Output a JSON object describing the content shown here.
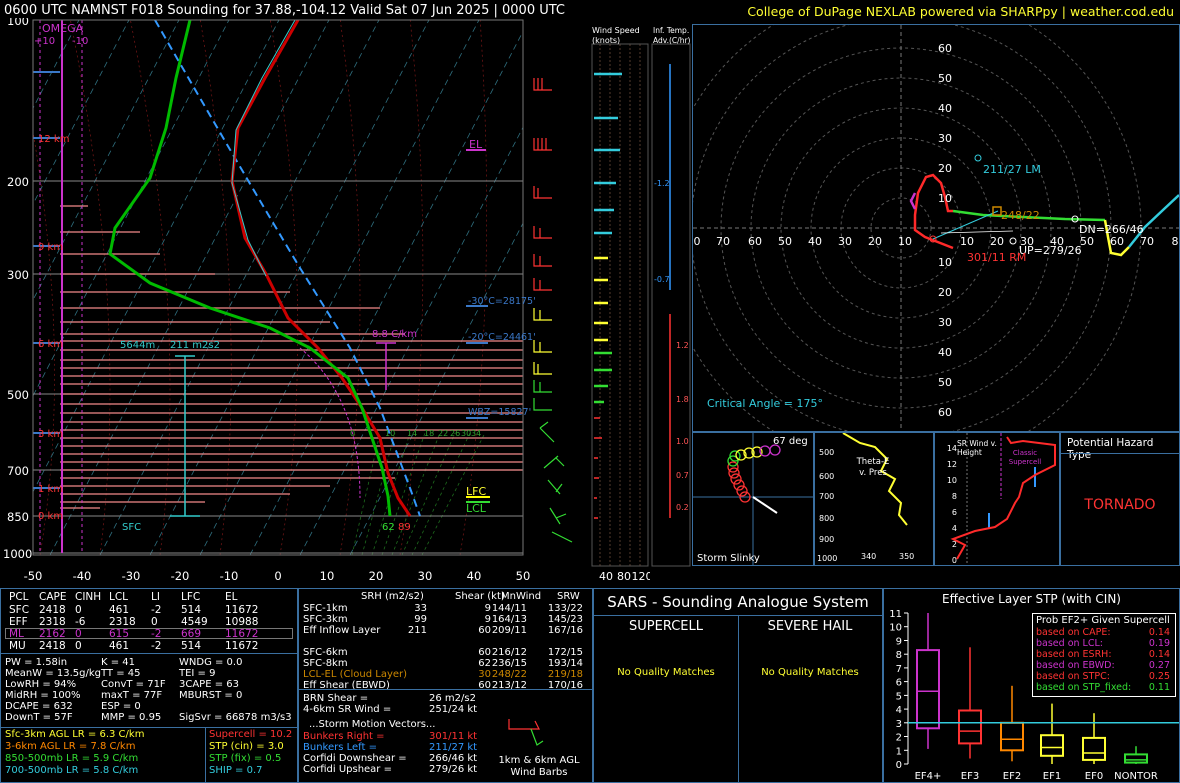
{
  "header": {
    "title": "0600 UTC NAMNST F018 Sounding for 37.88,-104.12 Valid  Sat 07 Jun 2025 | 0000 UTC",
    "credit": "College of DuPage NEXLAB powered via SHARPpy | weather.cod.edu"
  },
  "colors": {
    "temp": "#dd0000",
    "dewpoint": "#00bb00",
    "parcel": "#3399ff",
    "hodo_0_3": "#ff2a2a",
    "hodo_3_6": "#33dd33",
    "hodo_6_9": "#ffff33",
    "hodo_9_12": "#33ccdd",
    "omega": "#cc33cc",
    "accent_box": "#3a6fa0"
  },
  "skewt": {
    "p_ticks": [
      100,
      200,
      300,
      500,
      700,
      850,
      1000
    ],
    "x_ticks": [
      -50,
      -40,
      -30,
      -20,
      -10,
      0,
      10,
      20,
      30,
      40,
      50
    ],
    "height_labels": [
      "12 km",
      "9 km",
      "6 km",
      "3 km",
      "1 km",
      "0 km"
    ],
    "omega_label": "OMEGA",
    "omega_ticks": [
      "+10",
      "-10"
    ],
    "el_label": "EL",
    "lfc_label": "LFC",
    "lcl_label": "LCL",
    "lapse_label": "8.8 C/km",
    "isotherm_m30": "-30°C=28175'",
    "isotherm_m20": "-20°C=24461'",
    "wbz_label": "WBZ=15827'",
    "sfc_label": "SFC",
    "eff_inflow_depth": "5644m",
    "eff_srh": "211 m2s2",
    "sfc_t": "62",
    "sfc_td": "89",
    "wetbulb_ticks": [
      "0",
      "10",
      "14",
      "18",
      "22",
      "26",
      "30",
      "34"
    ]
  },
  "wind_speed_panel": {
    "title": "Wind Speed (knots)",
    "ticks": [
      "40",
      "80",
      "120"
    ]
  },
  "temp_adv_panel": {
    "title": "Inf. Temp. Adv.(C/hr)",
    "values": [
      "-1.2",
      "-0.7",
      "1.2",
      "1.8",
      "1.0",
      "0.7",
      "0.2"
    ]
  },
  "hodograph": {
    "rings_up": [
      "60",
      "50",
      "40",
      "30",
      "20",
      "10"
    ],
    "rings_down": [
      "10",
      "20",
      "30",
      "40",
      "50",
      "60"
    ],
    "x_ticks": [
      "0",
      "70",
      "60",
      "50",
      "40",
      "30",
      "20",
      "10",
      "10",
      "20",
      "30",
      "40",
      "50",
      "60",
      "70",
      "8"
    ],
    "lm": "211/27 LM",
    "rm": "301/11 RM",
    "mean": "248/22",
    "dn": "DN=266/46",
    "up": "UP=279/26",
    "critical_angle": "Critical Angle = 175°"
  },
  "slinky": {
    "title": "Storm Slinky",
    "deg": "67 deg"
  },
  "theta_panel": {
    "title": "Theta-E v. Pres",
    "p_ticks": [
      "500",
      "600",
      "700",
      "800",
      "900",
      "1000"
    ],
    "x_ticks": [
      "340",
      "350"
    ]
  },
  "srwind_panel": {
    "title": "SR Wind v. Height",
    "y_ticks": [
      "14",
      "12",
      "10",
      "8",
      "6",
      "4",
      "2",
      "0"
    ],
    "label": "Classic Supercell"
  },
  "hazard": {
    "title": "Potential Hazard Type",
    "value": "TORNADO"
  },
  "parcel_table": {
    "header": [
      "PCL",
      "CAPE",
      "CINH",
      "LCL",
      "LI",
      "LFC",
      "EL"
    ],
    "rows": [
      [
        "SFC",
        "2418",
        "0",
        "461",
        "-2",
        "514",
        "11672"
      ],
      [
        "EFF",
        "2318",
        "-6",
        "2318",
        "0",
        "4549",
        "10988"
      ],
      [
        "ML",
        "2162",
        "0",
        "615",
        "-2",
        "669",
        "11672"
      ],
      [
        "MU",
        "2418",
        "0",
        "461",
        "-2",
        "514",
        "11672"
      ]
    ]
  },
  "indices": [
    [
      "PW = 1.58in",
      "K = 41",
      "WNDG = 0.0"
    ],
    [
      "MeanW = 13.5g/kg",
      "TT = 45",
      "TEI = 9"
    ],
    [
      "LowRH = 94%",
      "ConvT = 71F",
      "3CAPE = 63"
    ],
    [
      "MidRH = 100%",
      "maxT = 77F",
      "MBURST = 0"
    ],
    [
      "DCAPE = 632",
      "ESP = 0",
      ""
    ],
    [
      "DownT = 57F",
      "MMP = 0.95",
      "SigSvr = 66878 m3/s3"
    ]
  ],
  "lapse_rates": [
    "Sfc-3km AGL LR = 6.3 C/km",
    "3-6km AGL LR = 7.8 C/km",
    "850-500mb LR = 5.9 C/km",
    "700-500mb LR = 5.8 C/km"
  ],
  "composite": [
    "Supercell = 10.2",
    "STP (cin) = 3.0",
    "STP (fix) = 0.5",
    "SHIP = 0.7"
  ],
  "kinematics": {
    "header": [
      "SRH (m2/s2)",
      "Shear (kt)",
      "MnWind",
      "SRW"
    ],
    "rows": [
      [
        "SFC-1km",
        "33",
        "9",
        "144/11",
        "133/22"
      ],
      [
        "SFC-3km",
        "99",
        "9",
        "164/13",
        "145/23"
      ],
      [
        "Eff Inflow Layer",
        "211",
        "60",
        "209/11",
        "167/16"
      ],
      [
        "",
        "",
        "",
        "",
        ""
      ],
      [
        "SFC-6km",
        "",
        "60",
        "216/12",
        "172/15"
      ],
      [
        "SFC-8km",
        "",
        "62",
        "236/15",
        "193/14"
      ],
      [
        "LCL-EL (Cloud Layer)",
        "",
        "30",
        "248/22",
        "219/18"
      ],
      [
        "Eff Shear (EBWD)",
        "",
        "60",
        "213/12",
        "170/16"
      ]
    ],
    "brn": "BRN Shear =",
    "brn_val": "26 m2/s2",
    "sr46": "4-6km SR Wind =",
    "sr46_val": "251/24 kt",
    "motion_title": "...Storm Motion Vectors...",
    "motion": [
      [
        "Bunkers Right =",
        "301/11 kt"
      ],
      [
        "Bunkers Left =",
        "211/27 kt"
      ],
      [
        "Corfidi Downshear =",
        "266/46 kt"
      ],
      [
        "Corfidi Upshear =",
        "279/26 kt"
      ]
    ],
    "barb_label": "1km & 6km AGL Wind Barbs"
  },
  "sars": {
    "title": "SARS - Sounding Analogue System",
    "supercell": "SUPERCELL",
    "hail": "SEVERE HAIL",
    "nomatch": "No Quality Matches"
  },
  "stp": {
    "title": "Effective Layer STP (with CIN)",
    "y_ticks": [
      "11",
      "10",
      "9",
      "8",
      "7",
      "6",
      "5",
      "4",
      "3",
      "2",
      "1",
      "0"
    ],
    "categories": [
      "EF4+",
      "EF3",
      "EF2",
      "EF1",
      "EF0",
      "NONTOR"
    ],
    "prob_title": "Prob EF2+ Given Supercell",
    "probs": [
      [
        "based on CAPE:",
        "0.14"
      ],
      [
        "based on LCL:",
        "0.19"
      ],
      [
        "based on ESRH:",
        "0.14"
      ],
      [
        "based on EBWD:",
        "0.27"
      ],
      [
        "based on STPC:",
        "0.25"
      ],
      [
        "based on STP_fixed:",
        "0.11"
      ]
    ]
  },
  "chart_data": {
    "type": "line",
    "title": "0600 UTC NAMNST F018 Sounding for 37.88,-104.12 Valid  Sat 07 Jun 2025 | 0000 UTC",
    "xlabel": "",
    "ylabel": "",
    "yscale": "log-pressure",
    "ylim": [
      1000,
      100
    ],
    "xlim": [
      -50,
      50
    ],
    "series": [],
    "stp_boxes": [
      {
        "cat": "EF4+",
        "min": 1.1,
        "q1": 2.6,
        "med": 5.3,
        "q3": 8.3,
        "max": 11.0
      },
      {
        "cat": "EF3",
        "min": 0.4,
        "q1": 1.5,
        "med": 2.4,
        "q3": 3.9,
        "max": 8.5
      },
      {
        "cat": "EF2",
        "min": 0.2,
        "q1": 1.0,
        "med": 1.8,
        "q3": 3.0,
        "max": 5.7
      },
      {
        "cat": "EF1",
        "min": 0.0,
        "q1": 0.6,
        "med": 1.2,
        "q3": 2.1,
        "max": 4.4
      },
      {
        "cat": "EF0",
        "min": 0.0,
        "q1": 0.3,
        "med": 0.8,
        "q3": 1.9,
        "max": 3.7
      },
      {
        "cat": "NONTOR",
        "min": 0.0,
        "q1": 0.1,
        "med": 0.3,
        "q3": 0.7,
        "max": 1.3
      }
    ],
    "stp_value": 3.0
  }
}
